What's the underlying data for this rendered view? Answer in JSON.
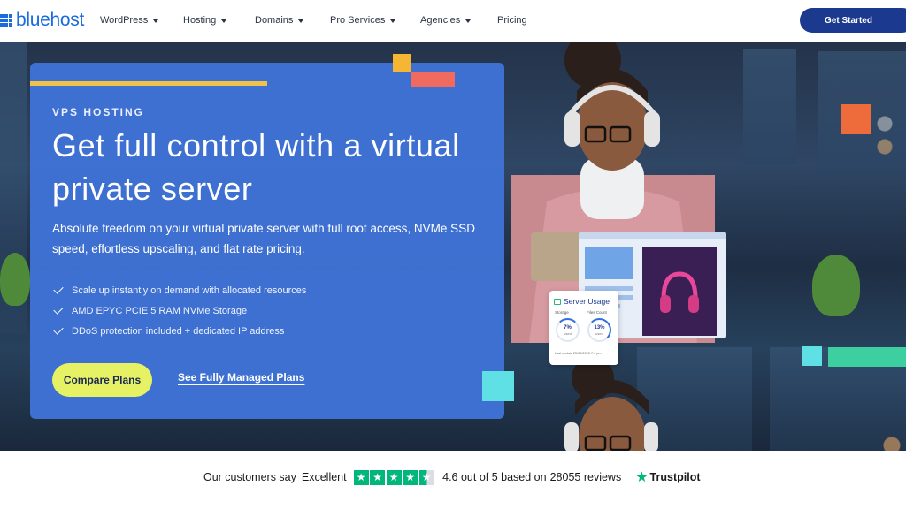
{
  "nav": {
    "brand": "bluehost",
    "items": [
      {
        "label": "WordPress",
        "dropdown": true
      },
      {
        "label": "Hosting",
        "dropdown": true
      },
      {
        "label": "Domains",
        "dropdown": true
      },
      {
        "label": "Pro Services",
        "dropdown": true
      },
      {
        "label": "Agencies",
        "dropdown": true
      },
      {
        "label": "Pricing",
        "dropdown": false
      }
    ],
    "cta": "Get Started"
  },
  "hero": {
    "eyebrow": "VPS HOSTING",
    "headline": "Get full control with a virtual private server",
    "subtitle": "Absolute freedom on your virtual private server with full root access, NVMe SSD speed, effortless upscaling, and flat rate pricing.",
    "features": [
      "Scale up instantly on demand with allocated resources",
      "AMD EPYC PCIE 5 RAM NVMe Storage",
      "DDoS protection included + dedicated IP address"
    ],
    "primary_button": "Compare Plans",
    "secondary_link": "See Fully Managed Plans"
  },
  "server_usage": {
    "title": "Server Usage",
    "storage_label": "Storage",
    "files_label": "Files Count",
    "storage_value": "7%",
    "files_value": "13%",
    "used_label": "used",
    "footer": "Last update 25/08/2025 7:9 pm"
  },
  "trustpilot": {
    "lead": "Our customers say",
    "rating_word": "Excellent",
    "rating_text": "4.6 out of 5 based on",
    "review_count": "28055 reviews",
    "brand": "Trustpilot",
    "stars": 4.5
  },
  "colors": {
    "brand_blue": "#196bde",
    "cta_navy": "#1b3a8f",
    "hero_card": "#3f72d6",
    "compare_yellow": "#e6f263",
    "trustpilot_green": "#00b67a"
  }
}
